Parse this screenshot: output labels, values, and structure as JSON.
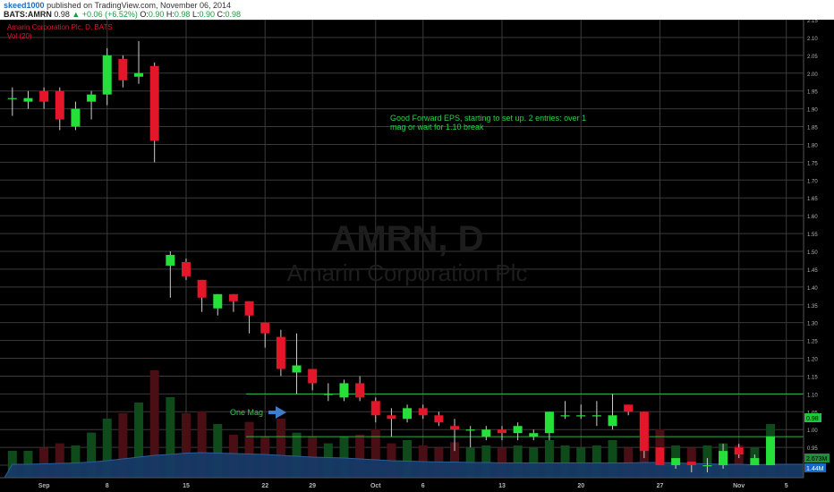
{
  "header": {
    "user": "skeed1000",
    "published": "published on TradingView.com, November 06, 2014",
    "symbol": "BATS:AMRN",
    "last": "0.98",
    "change": "▲ +0.06 (+6.52%)",
    "open_label": "O:",
    "open": "0.90",
    "high_label": "H:",
    "high": "0.98",
    "low_label": "L:",
    "low": "0.90",
    "close_label": "C:",
    "close": "0.98"
  },
  "legend": {
    "title": "Amarin Corporation Plc, D, BATS",
    "vol": "Vol (20)"
  },
  "watermark": {
    "symbol": "AMRN, D",
    "name": "Amarin Corporation Plc"
  },
  "annotations": {
    "note": "Good Forward EPS, starting to set up. 2 entries: over 1 mag or wait for 1.10 break",
    "note_line1": "Good Forward EPS, starting to set up. 2 entries: over 1",
    "note_line2": "mag or wait for 1.10 break",
    "arrow_label": "One Mag"
  },
  "badges": {
    "price": "0.98",
    "vol": "2.673M",
    "vol_ma": "1.44M"
  },
  "colors": {
    "background": "#000000",
    "grid": "#3a3a3a",
    "up": "#26e03a",
    "down": "#e3162a",
    "text_axis": "#b5b5b5",
    "note": "#2bd24b",
    "volume_area": "#163a66"
  },
  "chart_data": {
    "type": "candlestick",
    "title": "Amarin Corporation Plc, D, BATS",
    "ylim": [
      0.865,
      2.15
    ],
    "y_ticks": [
      "2.15",
      "2.10",
      "2.05",
      "2.00",
      "1.95",
      "1.90",
      "1.85",
      "1.80",
      "1.75",
      "1.70",
      "1.65",
      "1.60",
      "1.55",
      "1.50",
      "1.45",
      "1.40",
      "1.35",
      "1.30",
      "1.25",
      "1.20",
      "1.15",
      "1.10",
      "1.05",
      "1.00",
      "0.95",
      "0.90"
    ],
    "x_labels": [
      "Sep",
      "8",
      "15",
      "22",
      "29",
      "Oct",
      "6",
      "13",
      "20",
      "27",
      "Nov",
      "5"
    ],
    "x_label_slots": [
      2,
      6,
      11,
      16,
      19,
      23,
      26,
      31,
      36,
      41,
      46,
      49
    ],
    "levels": [
      1.1,
      0.98
    ],
    "candles": [
      {
        "o": 1.93,
        "h": 1.96,
        "l": 1.88,
        "c": 1.93
      },
      {
        "o": 1.92,
        "h": 1.95,
        "l": 1.9,
        "c": 1.93
      },
      {
        "o": 1.95,
        "h": 1.96,
        "l": 1.9,
        "c": 1.92
      },
      {
        "o": 1.95,
        "h": 1.96,
        "l": 1.84,
        "c": 1.87
      },
      {
        "o": 1.85,
        "h": 1.92,
        "l": 1.84,
        "c": 1.9
      },
      {
        "o": 1.92,
        "h": 1.95,
        "l": 1.87,
        "c": 1.94
      },
      {
        "o": 1.94,
        "h": 2.07,
        "l": 1.91,
        "c": 2.05
      },
      {
        "o": 2.04,
        "h": 2.05,
        "l": 1.96,
        "c": 1.98
      },
      {
        "o": 1.99,
        "h": 2.09,
        "l": 1.97,
        "c": 2.0
      },
      {
        "o": 2.02,
        "h": 2.03,
        "l": 1.75,
        "c": 1.81
      },
      {
        "o": 1.46,
        "h": 1.5,
        "l": 1.37,
        "c": 1.49
      },
      {
        "o": 1.47,
        "h": 1.48,
        "l": 1.42,
        "c": 1.43
      },
      {
        "o": 1.42,
        "h": 1.42,
        "l": 1.33,
        "c": 1.37
      },
      {
        "o": 1.34,
        "h": 1.38,
        "l": 1.32,
        "c": 1.38
      },
      {
        "o": 1.38,
        "h": 1.38,
        "l": 1.33,
        "c": 1.36
      },
      {
        "o": 1.36,
        "h": 1.36,
        "l": 1.27,
        "c": 1.32
      },
      {
        "o": 1.3,
        "h": 1.3,
        "l": 1.23,
        "c": 1.27
      },
      {
        "o": 1.26,
        "h": 1.28,
        "l": 1.15,
        "c": 1.17
      },
      {
        "o": 1.16,
        "h": 1.27,
        "l": 1.1,
        "c": 1.18
      },
      {
        "o": 1.17,
        "h": 1.17,
        "l": 1.11,
        "c": 1.13
      },
      {
        "o": 1.1,
        "h": 1.13,
        "l": 1.08,
        "c": 1.1
      },
      {
        "o": 1.09,
        "h": 1.14,
        "l": 1.08,
        "c": 1.13
      },
      {
        "o": 1.13,
        "h": 1.15,
        "l": 1.08,
        "c": 1.09
      },
      {
        "o": 1.08,
        "h": 1.09,
        "l": 1.02,
        "c": 1.04
      },
      {
        "o": 1.04,
        "h": 1.06,
        "l": 0.98,
        "c": 1.03
      },
      {
        "o": 1.03,
        "h": 1.07,
        "l": 1.02,
        "c": 1.06
      },
      {
        "o": 1.06,
        "h": 1.07,
        "l": 1.03,
        "c": 1.04
      },
      {
        "o": 1.04,
        "h": 1.05,
        "l": 1.01,
        "c": 1.02
      },
      {
        "o": 1.01,
        "h": 1.03,
        "l": 0.94,
        "c": 1.0
      },
      {
        "o": 1.0,
        "h": 1.01,
        "l": 0.95,
        "c": 1.0
      },
      {
        "o": 0.98,
        "h": 1.01,
        "l": 0.97,
        "c": 1.0
      },
      {
        "o": 1.0,
        "h": 1.01,
        "l": 0.97,
        "c": 0.99
      },
      {
        "o": 0.99,
        "h": 1.02,
        "l": 0.97,
        "c": 1.01
      },
      {
        "o": 0.98,
        "h": 1.0,
        "l": 0.97,
        "c": 0.99
      },
      {
        "o": 0.99,
        "h": 1.05,
        "l": 0.97,
        "c": 1.05
      },
      {
        "o": 1.04,
        "h": 1.08,
        "l": 1.03,
        "c": 1.04
      },
      {
        "o": 1.04,
        "h": 1.07,
        "l": 1.03,
        "c": 1.04
      },
      {
        "o": 1.04,
        "h": 1.08,
        "l": 1.01,
        "c": 1.04
      },
      {
        "o": 1.01,
        "h": 1.1,
        "l": 1.0,
        "c": 1.04
      },
      {
        "o": 1.07,
        "h": 1.07,
        "l": 1.04,
        "c": 1.05
      },
      {
        "o": 1.05,
        "h": 1.05,
        "l": 0.92,
        "c": 0.94
      },
      {
        "o": 0.95,
        "h": 0.95,
        "l": 0.9,
        "c": 0.9
      },
      {
        "o": 0.9,
        "h": 0.92,
        "l": 0.89,
        "c": 0.92
      },
      {
        "o": 0.91,
        "h": 0.91,
        "l": 0.88,
        "c": 0.9
      },
      {
        "o": 0.9,
        "h": 0.92,
        "l": 0.88,
        "c": 0.9
      },
      {
        "o": 0.9,
        "h": 0.96,
        "l": 0.89,
        "c": 0.94
      },
      {
        "o": 0.95,
        "h": 0.96,
        "l": 0.92,
        "c": 0.93
      },
      {
        "o": 0.9,
        "h": 0.93,
        "l": 0.9,
        "c": 0.92
      },
      {
        "o": 0.9,
        "h": 0.98,
        "l": 0.9,
        "c": 0.98
      }
    ],
    "volume": [
      0.25,
      0.25,
      0.28,
      0.32,
      0.3,
      0.42,
      0.55,
      0.6,
      0.7,
      1.0,
      0.75,
      0.6,
      0.62,
      0.5,
      0.4,
      0.52,
      0.38,
      0.55,
      0.42,
      0.38,
      0.32,
      0.38,
      0.4,
      0.45,
      0.32,
      0.35,
      0.3,
      0.28,
      0.33,
      0.28,
      0.3,
      0.28,
      0.3,
      0.28,
      0.35,
      0.3,
      0.28,
      0.3,
      0.35,
      0.28,
      0.55,
      0.45,
      0.3,
      0.28,
      0.3,
      0.32,
      0.3,
      0.28,
      0.5
    ],
    "volume_ma": [
      0.3,
      0.3,
      0.31,
      0.32,
      0.33,
      0.35,
      0.38,
      0.42,
      0.46,
      0.5,
      0.52,
      0.55,
      0.56,
      0.55,
      0.54,
      0.53,
      0.52,
      0.5,
      0.48,
      0.46,
      0.45,
      0.44,
      0.42,
      0.4,
      0.38,
      0.37,
      0.36,
      0.35,
      0.35,
      0.34,
      0.34,
      0.33,
      0.33,
      0.33,
      0.33,
      0.33,
      0.33,
      0.33,
      0.33,
      0.33,
      0.34,
      0.34,
      0.33,
      0.32,
      0.31,
      0.3,
      0.3,
      0.29,
      0.3
    ]
  }
}
